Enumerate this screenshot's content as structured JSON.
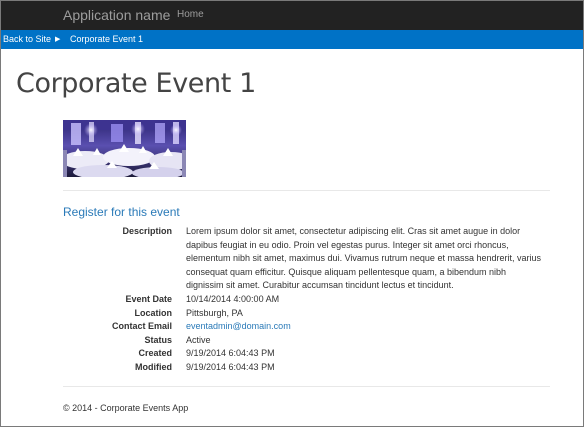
{
  "navbar": {
    "brand": "Application name",
    "home": "Home"
  },
  "breadcrumb": {
    "back": "Back to Site",
    "current": "Corporate Event 1"
  },
  "event": {
    "title": "Corporate Event 1",
    "register_link": "Register for this event",
    "fields": {
      "description_label": "Description",
      "description": "Lorem ipsum dolor sit amet, consectetur adipiscing elit. Cras sit amet augue in dolor dapibus feugiat in eu odio. Proin vel egestas purus. Integer sit amet orci rhoncus, elementum nibh sit amet, maximus dui. Vivamus rutrum neque et massa hendrerit, varius consequat quam efficitur. Quisque aliquam pellentesque quam, a bibendum nibh dignissim sit amet. Curabitur accumsan tincidunt lectus et tincidunt.",
      "date_label": "Event Date",
      "date": "10/14/2014 4:00:00 AM",
      "location_label": "Location",
      "location": "Pittsburgh, PA",
      "email_label": "Contact Email",
      "email": "eventadmin@domain.com",
      "status_label": "Status",
      "status": "Active",
      "created_label": "Created",
      "created": "9/19/2014 6:04:43 PM",
      "modified_label": "Modified",
      "modified": "9/19/2014 6:04:43 PM"
    }
  },
  "footer": {
    "text": "© 2014 - Corporate Events App"
  },
  "colors": {
    "navbar_bg": "#222222",
    "crumb_bg": "#0072c6",
    "link": "#2a7ab8"
  },
  "icons": {
    "crumb_separator": "caret-right-icon"
  }
}
